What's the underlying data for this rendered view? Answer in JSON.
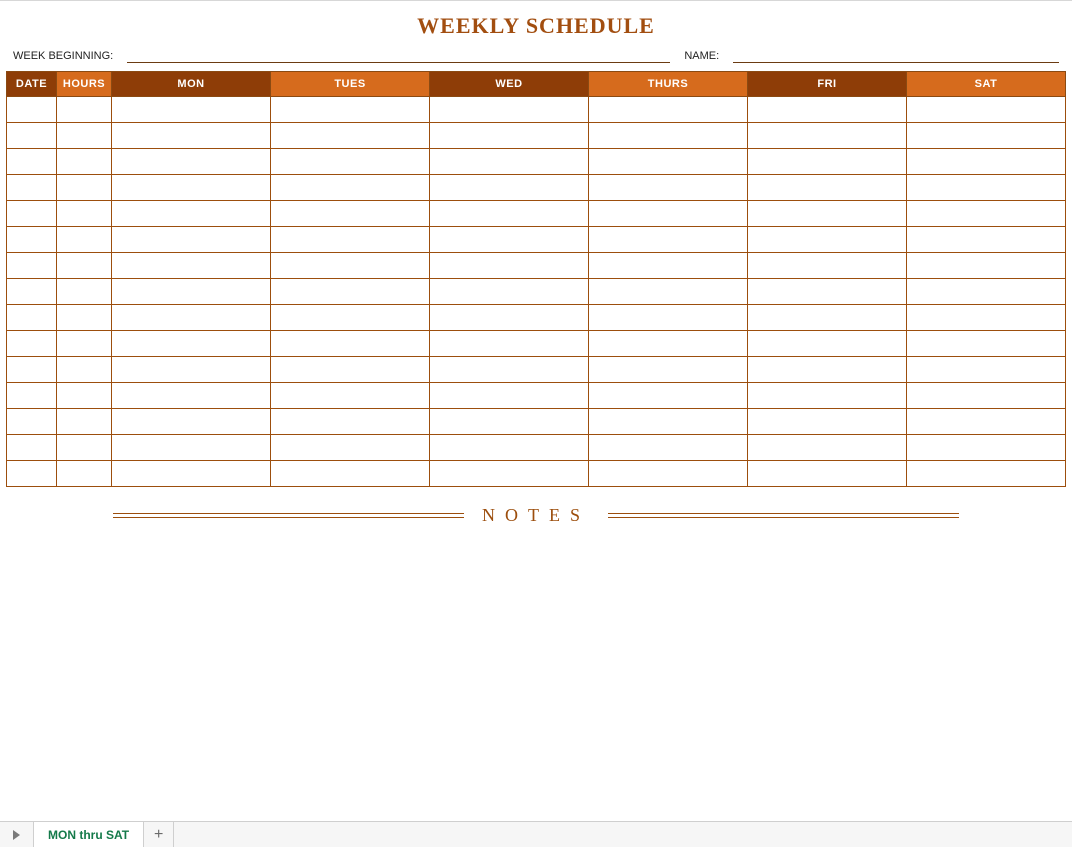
{
  "title": "WEEKLY SCHEDULE",
  "meta": {
    "week_label": "WEEK BEGINNING:",
    "week_value": "",
    "name_label": "NAME:",
    "name_value": ""
  },
  "headers": {
    "date": "DATE",
    "hours": "HOURS",
    "days": [
      "MON",
      "TUES",
      "WED",
      "THURS",
      "FRI",
      "SAT"
    ]
  },
  "row_count": 15,
  "notes_label": "NOTES",
  "tabs": {
    "active": "MON thru SAT"
  },
  "colors": {
    "dark_header": "#8e3d07",
    "light_header": "#d66b1d",
    "border": "#9c4e0d",
    "title": "#a24e10"
  }
}
